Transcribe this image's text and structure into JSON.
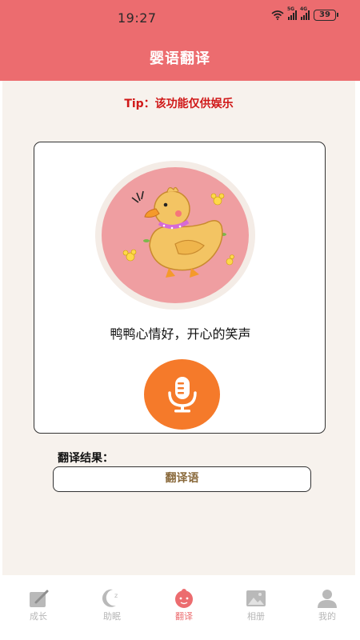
{
  "status_bar": {
    "time": "19:27",
    "sig1_label": "5G",
    "sig2_label": "4G",
    "battery": "39"
  },
  "header": {
    "title": "婴语翻译"
  },
  "tip": "Tip：该功能仅供娱乐",
  "card": {
    "mood_text": "鸭鸭心情好，开心的笑声"
  },
  "result": {
    "label": "翻译结果：",
    "value": "翻译语"
  },
  "tabs": [
    {
      "label": "成长",
      "icon": "pencil-note-icon",
      "active": false
    },
    {
      "label": "助眠",
      "icon": "moon-icon",
      "active": false
    },
    {
      "label": "翻译",
      "icon": "baby-face-icon",
      "active": true
    },
    {
      "label": "相册",
      "icon": "photo-icon",
      "active": false
    },
    {
      "label": "我的",
      "icon": "user-icon",
      "active": false
    }
  ],
  "colors": {
    "header": "#ec6c6f",
    "tip": "#d01818",
    "mic_button": "#f57a2a",
    "active_tab": "#ec6c6f",
    "background": "#f7f2ed"
  }
}
